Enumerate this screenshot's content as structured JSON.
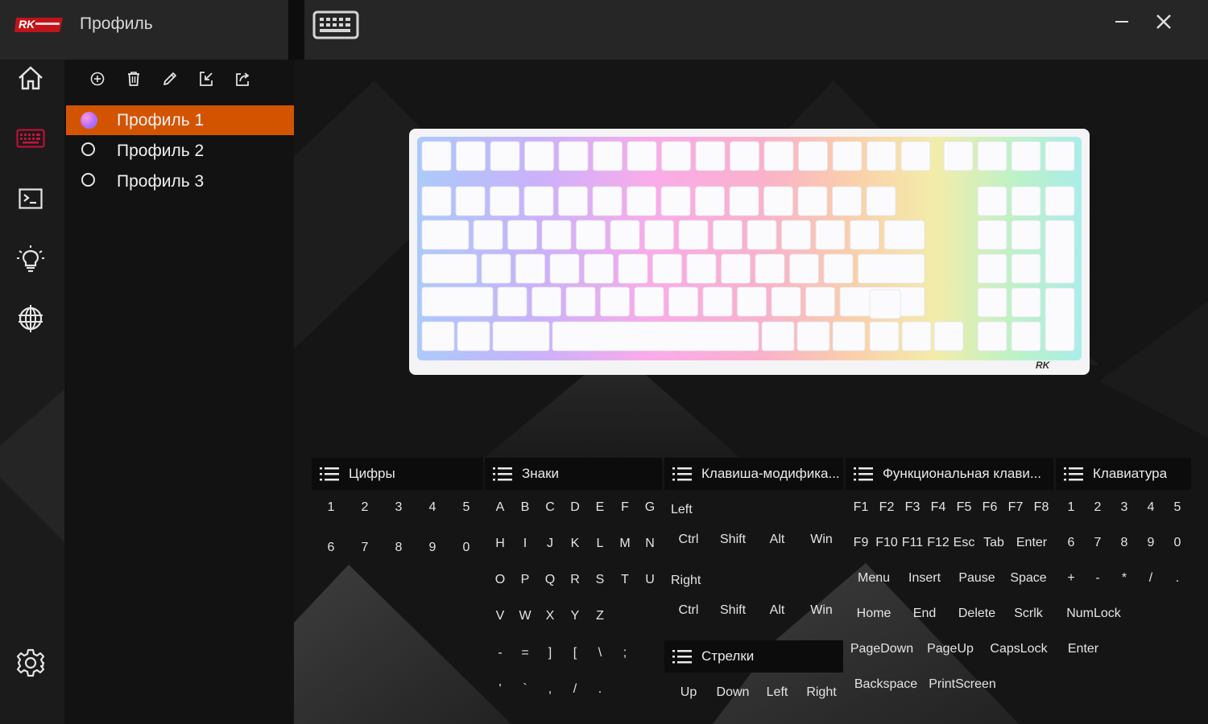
{
  "app": {
    "title": "Профиль"
  },
  "colors": {
    "accent": "#d35400",
    "background": "#151515",
    "panel": "#262626"
  },
  "icons": {
    "logo": "rk-logo",
    "device": "keyboard-icon",
    "window": [
      "minimize-icon",
      "close-icon"
    ],
    "nav": [
      "home-icon",
      "keyboard-icon",
      "terminal-icon",
      "lightbulb-icon",
      "globe-icon",
      "gear-icon"
    ],
    "profile_toolbar": [
      "add-icon",
      "trash-icon",
      "pencil-icon",
      "import-icon",
      "export-icon"
    ]
  },
  "profiles": [
    {
      "label": "Профиль 1",
      "active": true
    },
    {
      "label": "Профиль 2",
      "active": false
    },
    {
      "label": "Профиль 3",
      "active": false
    }
  ],
  "categories": {
    "digits": {
      "title": "Цифры",
      "rows": [
        [
          "1",
          "2",
          "3",
          "4",
          "5"
        ],
        [
          "6",
          "7",
          "8",
          "9",
          "0"
        ]
      ]
    },
    "signs": {
      "title": "Знаки",
      "rows": [
        [
          "A",
          "B",
          "C",
          "D",
          "E",
          "F",
          "G"
        ],
        [
          "H",
          "I",
          "J",
          "K",
          "L",
          "M",
          "N"
        ],
        [
          "O",
          "P",
          "Q",
          "R",
          "S",
          "T",
          "U"
        ],
        [
          "V",
          "W",
          "X",
          "Y",
          "Z"
        ],
        [
          "-",
          "=",
          "]",
          "[",
          "\\",
          ";"
        ],
        [
          "'",
          "`",
          ",",
          "/",
          "."
        ]
      ]
    },
    "modifiers": {
      "title": "Клавиша-модифика...",
      "left_label": "Left",
      "left": [
        "Ctrl",
        "Shift",
        "Alt",
        "Win"
      ],
      "right_label": "Right",
      "right": [
        "Ctrl",
        "Shift",
        "Alt",
        "Win"
      ]
    },
    "arrows": {
      "title": "Стрелки",
      "keys": [
        "Up",
        "Down",
        "Left",
        "Right"
      ]
    },
    "function": {
      "title": "Функциональная клави...",
      "row1": [
        "F1",
        "F2",
        "F3",
        "F4",
        "F5",
        "F6",
        "F7",
        "F8"
      ],
      "row2": [
        "F9",
        "F10",
        "F11",
        "F12",
        "Esc",
        "Tab",
        "Enter"
      ],
      "row3": [
        "Menu",
        "Insert",
        "Pause",
        "Space"
      ],
      "row4": [
        "Home",
        "End",
        "Delete",
        "Scrlk"
      ],
      "row5": [
        "PageDown",
        "PageUp",
        "CapsLock"
      ],
      "row6": [
        "Backspace",
        "PrintScreen"
      ]
    },
    "keypad": {
      "title": "Клавиатура",
      "row1": [
        "1",
        "2",
        "3",
        "4",
        "5"
      ],
      "row2": [
        "6",
        "7",
        "8",
        "9",
        "0"
      ],
      "row3": [
        "+",
        "-",
        "*",
        "/",
        "."
      ],
      "row4": [
        "NumLock"
      ],
      "row5": [
        "Enter"
      ]
    }
  }
}
